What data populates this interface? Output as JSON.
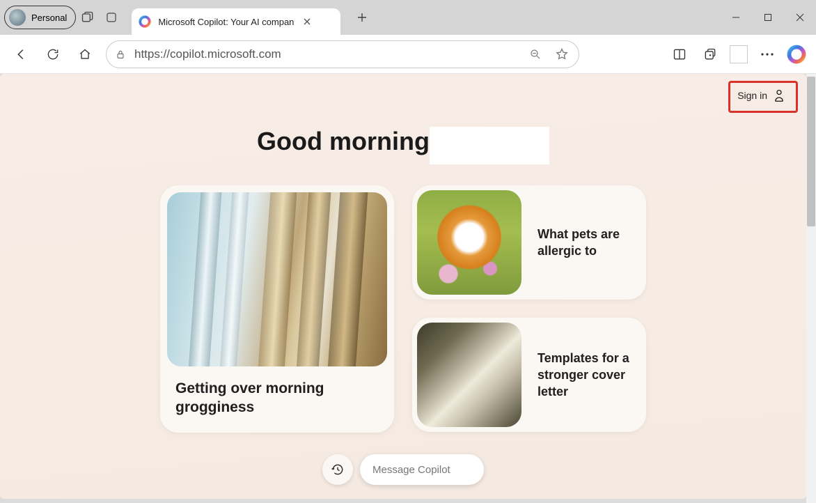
{
  "browser": {
    "profile_label": "Personal",
    "tab_title": "Microsoft Copilot: Your AI compan",
    "url": "https://copilot.microsoft.com"
  },
  "page": {
    "signin_label": "Sign in",
    "greeting": "Good morning",
    "cards": {
      "big_title": "Getting over morning grogginess",
      "small1_title": "What pets are allergic to",
      "small2_title": "Templates for a stronger cover letter"
    },
    "message_placeholder": "Message Copilot"
  }
}
